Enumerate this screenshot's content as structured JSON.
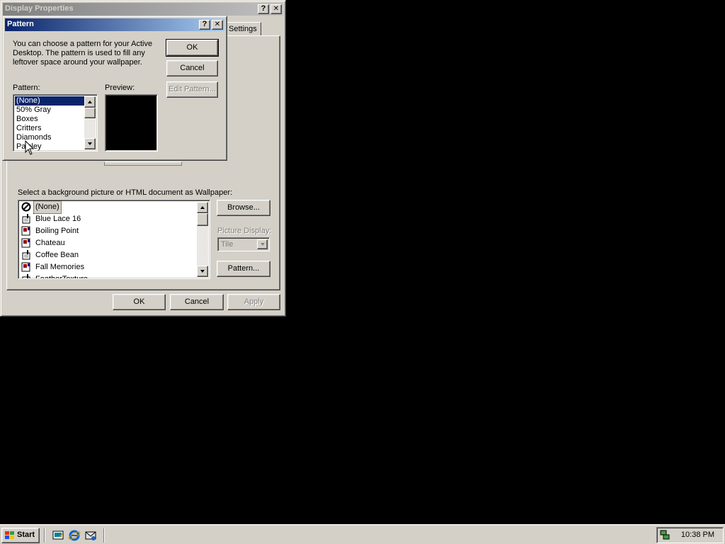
{
  "display_properties": {
    "title": "Display Properties",
    "help_button": "?",
    "close_button": "✕",
    "visible_tab": "Settings",
    "wallpaper_label": "Select a background picture or HTML document as Wallpaper:",
    "wallpapers": [
      "(None)",
      "Blue Lace 16",
      "Boiling Point",
      "Chateau",
      "Coffee Bean",
      "Fall Memories",
      "FeatherTexture"
    ],
    "browse_button": "Browse...",
    "picture_display_label": "Picture Display:",
    "picture_display_value": "Tile",
    "pattern_button": "Pattern...",
    "ok_button": "OK",
    "cancel_button": "Cancel",
    "apply_button": "Apply"
  },
  "pattern_dialog": {
    "title": "Pattern",
    "help_button": "?",
    "close_button": "✕",
    "description": "You can choose a pattern for your Active Desktop.  The pattern is used to fill any leftover space around your wallpaper.",
    "pattern_label": "Pattern:",
    "preview_label": "Preview:",
    "patterns": [
      "(None)",
      "50% Gray",
      "Boxes",
      "Critters",
      "Diamonds",
      "Paisley"
    ],
    "selected_pattern": "(None)",
    "ok_button": "OK",
    "cancel_button": "Cancel",
    "edit_pattern_button": "Edit Pattern...",
    "preview_color": "#000000"
  },
  "taskbar": {
    "start_label": "Start",
    "quick_launch": [
      "show-desktop-icon",
      "internet-explorer-icon",
      "outlook-express-icon"
    ],
    "clock": "10:38 PM"
  },
  "colors": {
    "desktop": "#000000",
    "face": "#d4d0c8",
    "active_title": "#0a246a",
    "inactive_title": "#808080",
    "selection": "#0a246a"
  }
}
